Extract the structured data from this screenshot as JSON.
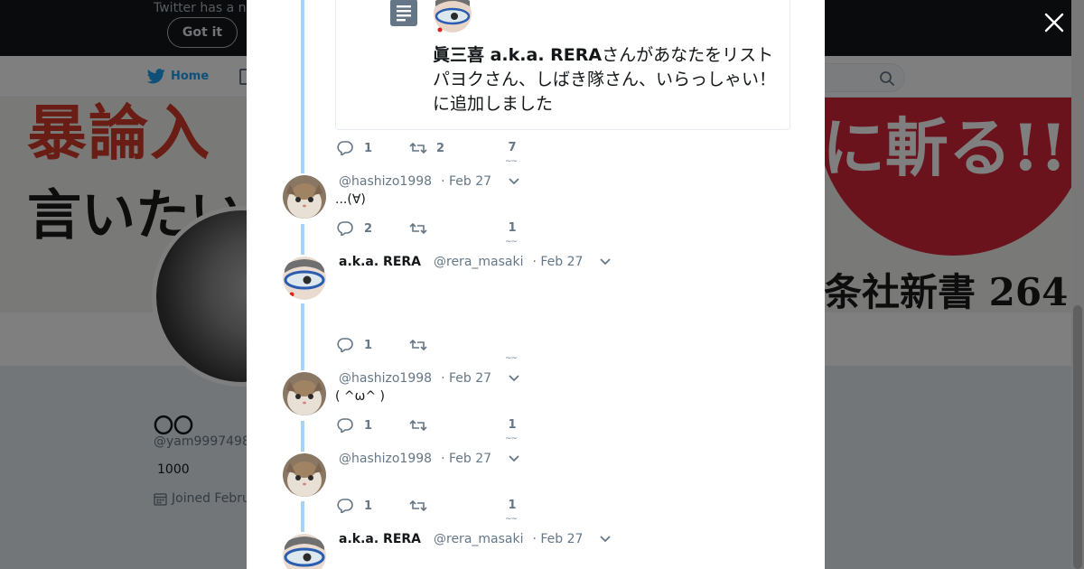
{
  "background": {
    "cookie_bar": {
      "text": "Twitter has a n",
      "got_it_label": "Got it"
    },
    "nav": {
      "home_label": "Home"
    },
    "banner": {
      "left_line1": "暴論入",
      "left_line2": "言いたい",
      "right_line1": "に斬る!!",
      "right_line2": "条社新書 264"
    },
    "profile": {
      "name": "〇〇",
      "handle": "@yam9997498",
      "count": "1000",
      "joined": "Joined Febru"
    }
  },
  "modal": {
    "close_icon": "close-icon",
    "quote_card": {
      "author_bold": "眞三喜 a.k.a. RERA",
      "text_rest": "さんがあなたをリストパヨクさん、しばき隊さん、いらっしゃい！に追加しました"
    },
    "tweets": [
      {
        "name": "",
        "handle": "",
        "date": "",
        "text": "",
        "reply_count": "1",
        "retweet_count": "2",
        "like_count": "7"
      },
      {
        "name": "",
        "handle": "@hashizo1998",
        "date": "· Feb 27",
        "text": "...(∀)",
        "reply_count": "2",
        "retweet_count": "",
        "like_count": "1"
      },
      {
        "name": "a.k.a. RERA",
        "handle": "@rera_masaki",
        "date": "· Feb 27",
        "text": "",
        "reply_count": "1",
        "retweet_count": "",
        "like_count": ""
      },
      {
        "name": "",
        "handle": "@hashizo1998",
        "date": "· Feb 27",
        "text": "( ^ω^ )",
        "reply_count": "1",
        "retweet_count": "",
        "like_count": "1"
      },
      {
        "name": "",
        "handle": "@hashizo1998",
        "date": "· Feb 27",
        "text": "",
        "reply_count": "1",
        "retweet_count": "",
        "like_count": "1"
      },
      {
        "name": "a.k.a. RERA",
        "handle": "@rera_masaki",
        "date": "· Feb 27",
        "text": "",
        "reply_count": "",
        "retweet_count": "",
        "like_count": ""
      }
    ]
  },
  "colors": {
    "twitter_blue": "#1da1f2",
    "thread_line": "#a6d4f2",
    "muted_text": "#657786",
    "overlay": "rgba(0,0,0,0.5)"
  }
}
